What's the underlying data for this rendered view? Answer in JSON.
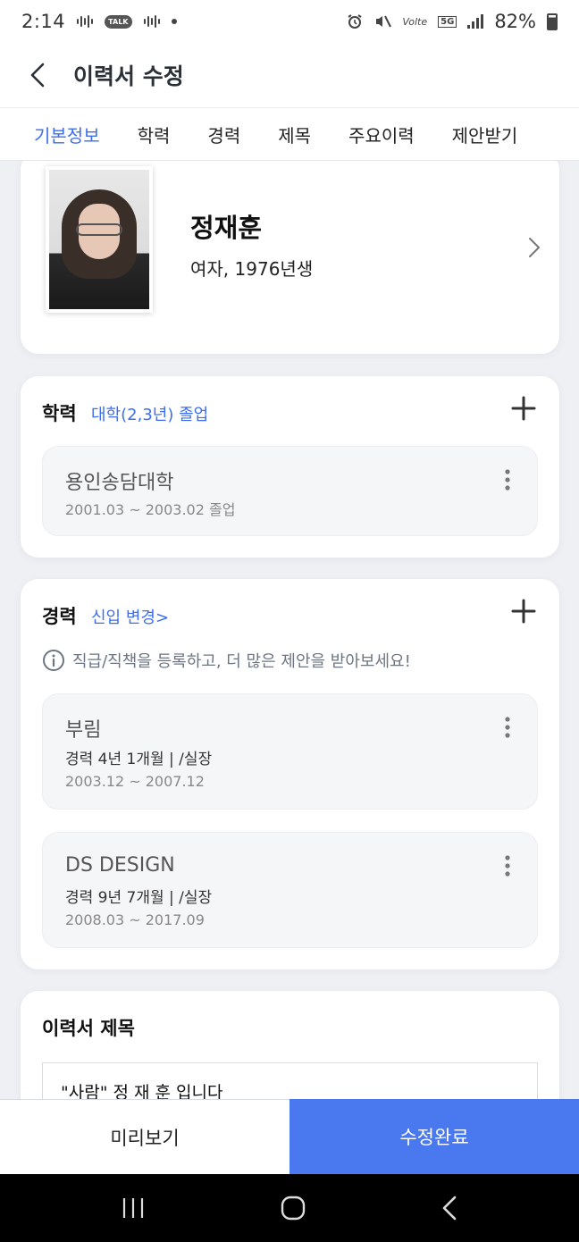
{
  "status_bar": {
    "time": "2:14",
    "talk_badge": "TALK",
    "network": "5G",
    "volte": "Volte",
    "battery": "82%"
  },
  "header": {
    "title": "이력서 수정"
  },
  "tabs": [
    {
      "label": "기본정보",
      "active": true
    },
    {
      "label": "학력",
      "active": false
    },
    {
      "label": "경력",
      "active": false
    },
    {
      "label": "제목",
      "active": false
    },
    {
      "label": "주요이력",
      "active": false
    },
    {
      "label": "제안받기",
      "active": false
    }
  ],
  "profile": {
    "name": "정재훈",
    "details": "여자, 1976년생"
  },
  "education": {
    "title": "학력",
    "tag": "대학(2,3년) 졸업",
    "items": [
      {
        "name": "용인송담대학",
        "date": "2001.03 ~ 2003.02 졸업"
      }
    ]
  },
  "experience": {
    "title": "경력",
    "tag": "신입 변경>",
    "info": "직급/직책을 등록하고, 더 많은 제안을 받아보세요!",
    "items": [
      {
        "name": "부림",
        "summary": "경력 4년 1개월 | /실장",
        "date": "2003.12 ~ 2007.12"
      },
      {
        "name": "DS DESIGN",
        "summary": "경력 9년 7개월 | /실장",
        "date": "2008.03 ~ 2017.09"
      }
    ]
  },
  "resume_title": {
    "title": "이력서 제목",
    "value": "\"사람\" 정 재 훈 입니다"
  },
  "bottom": {
    "preview_label": "미리보기",
    "done_label": "수정완료"
  },
  "colors": {
    "accent": "#3d6ef0",
    "primary_button": "#4a78ee"
  }
}
